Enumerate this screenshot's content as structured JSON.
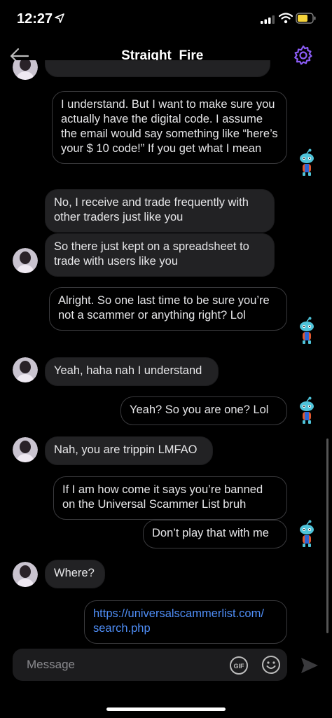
{
  "status": {
    "time": "12:27"
  },
  "header": {
    "title": "Straight_Fire_"
  },
  "messages": [
    {
      "side": "sent",
      "text": "I understand. But I want to make sure you actually have the digital code. I assume the email would say something like “here’s your $ 10 code!” If you get what I mean"
    },
    {
      "side": "recv",
      "text": "No, I receive and trade frequently with other traders just like you"
    },
    {
      "side": "recv",
      "text": "So there just kept on a spreadsheet to trade with users like you"
    },
    {
      "side": "sent",
      "text": "Alright. So one last time to be sure you’re not a scammer or anything right? Lol"
    },
    {
      "side": "recv",
      "text": "Yeah, haha nah I understand"
    },
    {
      "side": "sent",
      "text": "Yeah?  So you are one?  Lol"
    },
    {
      "side": "recv",
      "text": "Nah, you are trippin LMFAO"
    },
    {
      "side": "sent",
      "text": "If I am how come it says you’re banned on the Universal Scammer List bruh"
    },
    {
      "side": "sent",
      "text": "Don’t play that with me"
    },
    {
      "side": "recv",
      "text": "Where?"
    },
    {
      "side": "sent",
      "text": "https://universalscammerlist.com/search.php"
    }
  ],
  "link_lines": [
    "https://universalscammerlist.com/",
    "search.php"
  ],
  "composer": {
    "placeholder": "Message",
    "gif_label": "GIF"
  },
  "colors": {
    "background": "#000000",
    "accent": "#8b5cf6",
    "link": "#4f8ef7",
    "bubble": "#1c1c1e"
  },
  "icons": [
    "location-arrow-icon",
    "signal-icon",
    "wifi-icon",
    "battery-icon",
    "back-arrow-icon",
    "settings-gear-icon",
    "snoo-avatar-icon",
    "gif-icon",
    "emoji-icon",
    "send-icon"
  ]
}
